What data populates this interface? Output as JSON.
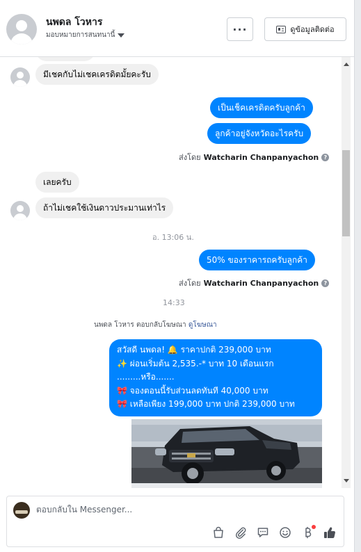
{
  "header": {
    "contact_name": "นพดล โวหาร",
    "assign_label": "มอบหมายการสนทนานี้",
    "more_label": "···",
    "info_button_label": "ดูข้อมูลติดต่อ"
  },
  "messages": {
    "in_1": "มีเชคกับไม่เชคเครดิตมั้ยคะรับ",
    "out_1": "เป็นเช็คเครดิตครับลูกค้า",
    "out_2": "ลูกค้าอยู่จังหวัดอะไรครับ",
    "in_2": "เลยครับ",
    "in_3": "ถ้าไม่เชคใช้เงินดาวประมานเท่าไร",
    "time_1": "อ. 13:06 น.",
    "out_3": "50% ของราคารถครับลูกค้า",
    "time_2": "14:33",
    "sent_by_prefix": "ส่งโดย",
    "sent_by_name": "Watcharin Chanpanyachon",
    "reply_note_prefix": "นพดล โวหาร ตอบกลับโฆษณา",
    "reply_note_link": "ดูโฆษณา"
  },
  "promo": {
    "line_1": "สวัสดี นพดล! 🔔  ราคาปกติ 239,000 บาท",
    "line_2": "✨  ผ่อนเริ่มต้น 2,535.-* บาท 10 เดือนแรก",
    "line_3": ".........หรือ.......",
    "line_4": "🎀 จองตอนนี้รับส่วนลดทันที 40,000 บาท",
    "line_5": "🎀  เหลือเพียง 199,000 บาท ปกติ 239,000 บาท"
  },
  "composer": {
    "placeholder": "ตอบกลับใน Messenger..."
  },
  "colors": {
    "outgoing_bubble": "#0084ff",
    "incoming_bubble": "#f0f0f0",
    "link": "#385898",
    "notification_dot": "#fa3e3e"
  },
  "icons": [
    "more-icon",
    "contact-card-icon",
    "chevron-down-icon",
    "help-icon",
    "shopping-bag-icon",
    "attachment-icon",
    "saved-replies-icon",
    "emoji-icon",
    "payment-icon",
    "thumbs-up-icon"
  ]
}
